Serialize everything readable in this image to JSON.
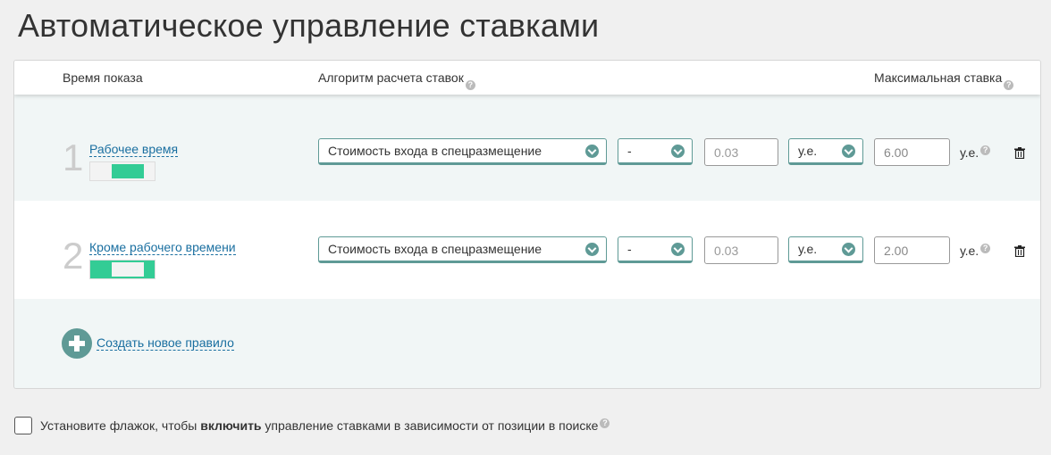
{
  "title": "Автоматическое управление ставками",
  "header": {
    "time": "Время показа",
    "algo": "Алгоритм расчета ставок",
    "max": "Максимальная ставка"
  },
  "rules": [
    {
      "num": "1",
      "time": "Рабочее время",
      "algo": "Стоимость входа в спецразмещение",
      "op": "-",
      "value": "0.03",
      "unit": "у.е.",
      "max": "6.00",
      "max_unit": "у.е."
    },
    {
      "num": "2",
      "time": "Кроме рабочего времени",
      "algo": "Стоимость входа в спецразмещение",
      "op": "-",
      "value": "0.03",
      "unit": "у.е.",
      "max": "2.00",
      "max_unit": "у.е."
    }
  ],
  "add_rule": "Создать новое правило",
  "checkbox": {
    "pre": "Установите флажок, чтобы ",
    "bold": "включить",
    "post": " управление ставками в зависимости от позиции в поиске",
    "checked": false
  },
  "help_glyph": "?"
}
